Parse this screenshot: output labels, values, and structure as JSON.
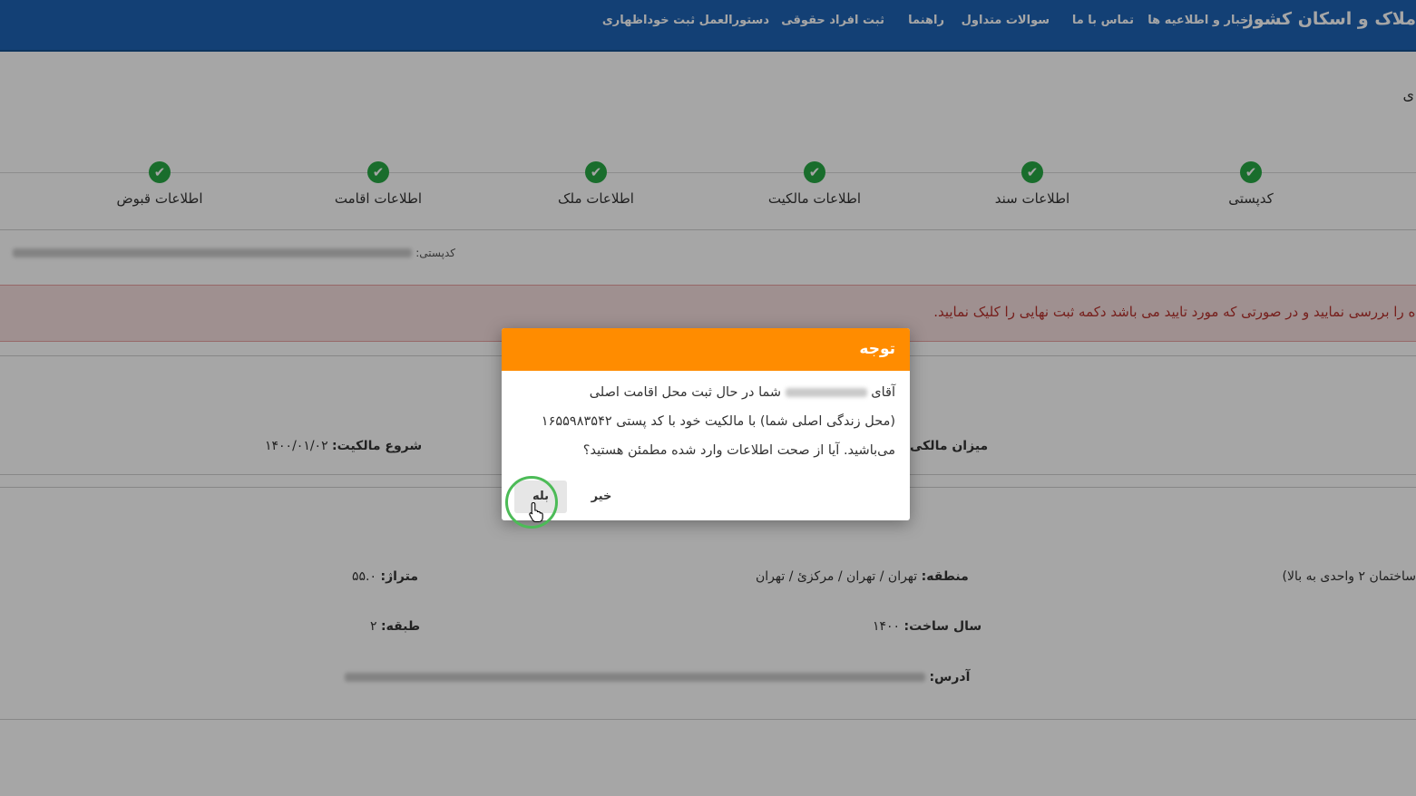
{
  "header": {
    "brand": "ملاک و اسکان کشور",
    "nav": [
      "اخبار و اطلاعیه ها",
      "تماس با ما",
      "سوالات متداول",
      "راهنما",
      "ثبت افراد حقوقی",
      "دستورالعمل ثبت خوداظهاری"
    ]
  },
  "page": {
    "corner_char": "ی",
    "steps": [
      "کدپستی",
      "اطلاعات سند",
      "اطلاعات مالکیت",
      "اطلاعات ملک",
      "اطلاعات اقامت",
      "اطلاعات قبوض"
    ],
    "step_status": "completed",
    "postal_label": "کدپستی:",
    "alert": "ده را بررسی نمایید و در صورتی که مورد تایید می باشد دکمه ثبت نهایی را کلیک نمایید.",
    "fields": {
      "ownership_amount_label": "میزان مالکی",
      "ownership_start_label": "شروع مالکیت:",
      "ownership_start_value": "۱۴۰۰/۰۱/۰۲",
      "building_type": "ساختمان ۲ واحدی به بالا)",
      "region_label": "منطقه:",
      "region_value": "تهران / تهران / مرکزئ / تهران",
      "area_label": "متراژ:",
      "area_value": "۵۵.۰",
      "year_label": "سال ساخت:",
      "year_value": "۱۴۰۰",
      "floor_label": "طبقه:",
      "floor_value": "۲",
      "address_label": "آدرس:"
    }
  },
  "modal": {
    "title": "توجه",
    "line1_prefix": "آقای",
    "line1_suffix": "شما در حال ثبت محل اقامت اصلی",
    "line2": "(محل زندگی اصلی شما) با مالکیت خود با کد پستی ۱۶۵۵۹۸۳۵۴۲",
    "line3": "می‌باشید. آیا از صحت اطلاعات وارد شده مطمئن هستید؟",
    "yes_label": "بله",
    "no_label": "خیر",
    "header_color": "#ff8c00"
  }
}
